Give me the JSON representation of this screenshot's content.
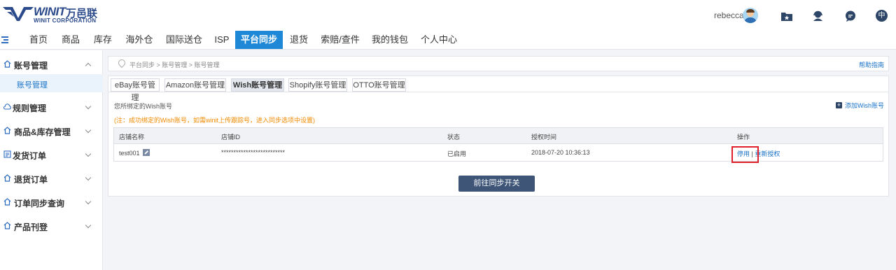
{
  "header": {
    "logo": {
      "brand": "WINIT",
      "brand_cn": "万邑联",
      "corp": "WINIT CORPORATION"
    },
    "user": {
      "name": "rebecca"
    },
    "icons": [
      "folder-star-icon",
      "customer-service-icon",
      "chat-icon",
      "language-icon"
    ],
    "language_label": "中"
  },
  "nav": {
    "items": [
      {
        "label": "首页"
      },
      {
        "label": "商品"
      },
      {
        "label": "库存"
      },
      {
        "label": "海外仓"
      },
      {
        "label": "国际送仓"
      },
      {
        "label": "ISP"
      },
      {
        "label": "平台同步",
        "active": true
      },
      {
        "label": "退货"
      },
      {
        "label": "索赔/查件"
      },
      {
        "label": "我的钱包"
      },
      {
        "label": "个人中心"
      }
    ],
    "active_color": "#1e88d6"
  },
  "sidebar": {
    "groups": [
      {
        "label": "账号管理",
        "icon": "home-icon",
        "expanded": true
      },
      {
        "label": "规则管理",
        "icon": "cloud-icon"
      },
      {
        "label": "商品&库存管理",
        "icon": "home-icon"
      },
      {
        "label": "发货订单",
        "icon": "list-icon"
      },
      {
        "label": "退货订单",
        "icon": "home-icon"
      },
      {
        "label": "订单同步查询",
        "icon": "home-icon"
      },
      {
        "label": "产品刊登",
        "icon": "home-icon"
      }
    ],
    "sub_active": "账号管理"
  },
  "breadcrumb": {
    "text": "平台同步 > 账号管理 > 账号管理",
    "help": "帮助指南"
  },
  "tabs": [
    {
      "label": "eBay账号管理"
    },
    {
      "label": "Amazon账号管理"
    },
    {
      "label": "Wish账号管理",
      "active": true
    },
    {
      "label": "Shopify账号管理"
    },
    {
      "label": "OTTO账号管理"
    }
  ],
  "content": {
    "bound_label": "您所绑定的Wish账号",
    "add_label": "添加Wish账号",
    "notice": "(注：成功绑定的Wish账号，如需winit上传跟踪号，进入同步选项中设置)",
    "notice_color": "#f08a00",
    "table": {
      "headers": [
        "店铺名称",
        "店铺ID",
        "状态",
        "授权时间",
        "操作"
      ],
      "rows": [
        {
          "name": "test001",
          "id": "**************************",
          "status": "已启用",
          "time": "2018-07-20 10:36:13",
          "op_disable": "停用",
          "op_sep": "|",
          "op_reauth": "重新授权"
        }
      ]
    },
    "sync_button": "前往同步开关"
  }
}
